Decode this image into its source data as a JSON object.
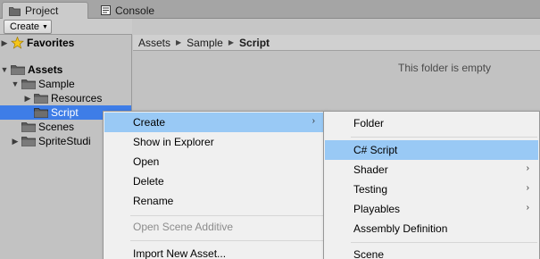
{
  "tabs": {
    "project": {
      "label": "Project",
      "icon": "folder-icon"
    },
    "console": {
      "label": "Console",
      "icon": "console-icon"
    }
  },
  "toolbar": {
    "create_label": "Create"
  },
  "tree": {
    "favorites": "Favorites",
    "assets": "Assets",
    "sample": "Sample",
    "resources": "Resources",
    "script": "Script",
    "scenes": "Scenes",
    "spritestudio": "SpriteStudi"
  },
  "breadcrumb": {
    "items": [
      "Assets",
      "Sample",
      "Script"
    ]
  },
  "content": {
    "empty_message": "This folder is empty"
  },
  "context_menu": {
    "items": [
      "Create",
      "Show in Explorer",
      "Open",
      "Delete",
      "Rename",
      "Open Scene Additive",
      "Import New Asset..."
    ]
  },
  "create_submenu": {
    "items": [
      "Folder",
      "C# Script",
      "Shader",
      "Testing",
      "Playables",
      "Assembly Definition",
      "Scene"
    ]
  },
  "colors": {
    "selection": "#3e7de7",
    "menu_highlight": "#99c9f5",
    "panel_bg": "#c2c2c2"
  }
}
